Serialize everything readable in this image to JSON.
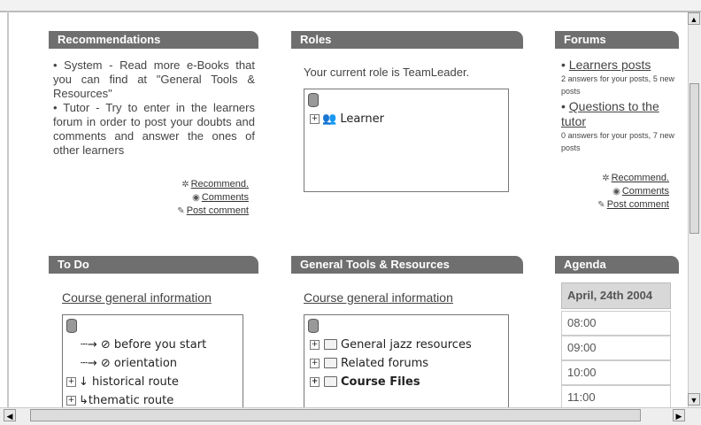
{
  "recommendations": {
    "header": "Recommendations",
    "text": "• System - Read more e-Books that you can find at \"General Tools & Resources\"\n• Tutor - Try to enter in the learners forum in order to post your doubts and comments and answer the ones of other learners",
    "links": [
      "Recommend.",
      "Comments",
      "Post comment"
    ]
  },
  "roles": {
    "header": "Roles",
    "current_role_text": "Your current role is TeamLeader.",
    "tree_item": "Learner"
  },
  "forums": {
    "header": "Forums",
    "item1_link": "Learners posts",
    "item1_meta": "2 answers for your posts, 5 new posts",
    "item2_link": "Questions to the tutor",
    "item2_meta": "0 answers for your posts, 7 new posts",
    "links": [
      "Recommend.",
      "Comments",
      "Post comment"
    ]
  },
  "todo": {
    "header": "To Do",
    "course_link": "Course general information",
    "tree": [
      "before you start",
      "orientation",
      "historical route",
      "thematic route"
    ]
  },
  "tools": {
    "header": "General Tools & Resources",
    "course_link": "Course general information",
    "tree": [
      "General jazz resources",
      "Related forums",
      "Course Files"
    ]
  },
  "agenda": {
    "header": "Agenda",
    "date": "April, 24th 2004",
    "slots": [
      "08:00",
      "09:00",
      "10:00",
      "11:00"
    ]
  },
  "icons": {
    "recommend": "sparkle-icon",
    "comments": "eye-icon",
    "post": "pencil-icon"
  }
}
